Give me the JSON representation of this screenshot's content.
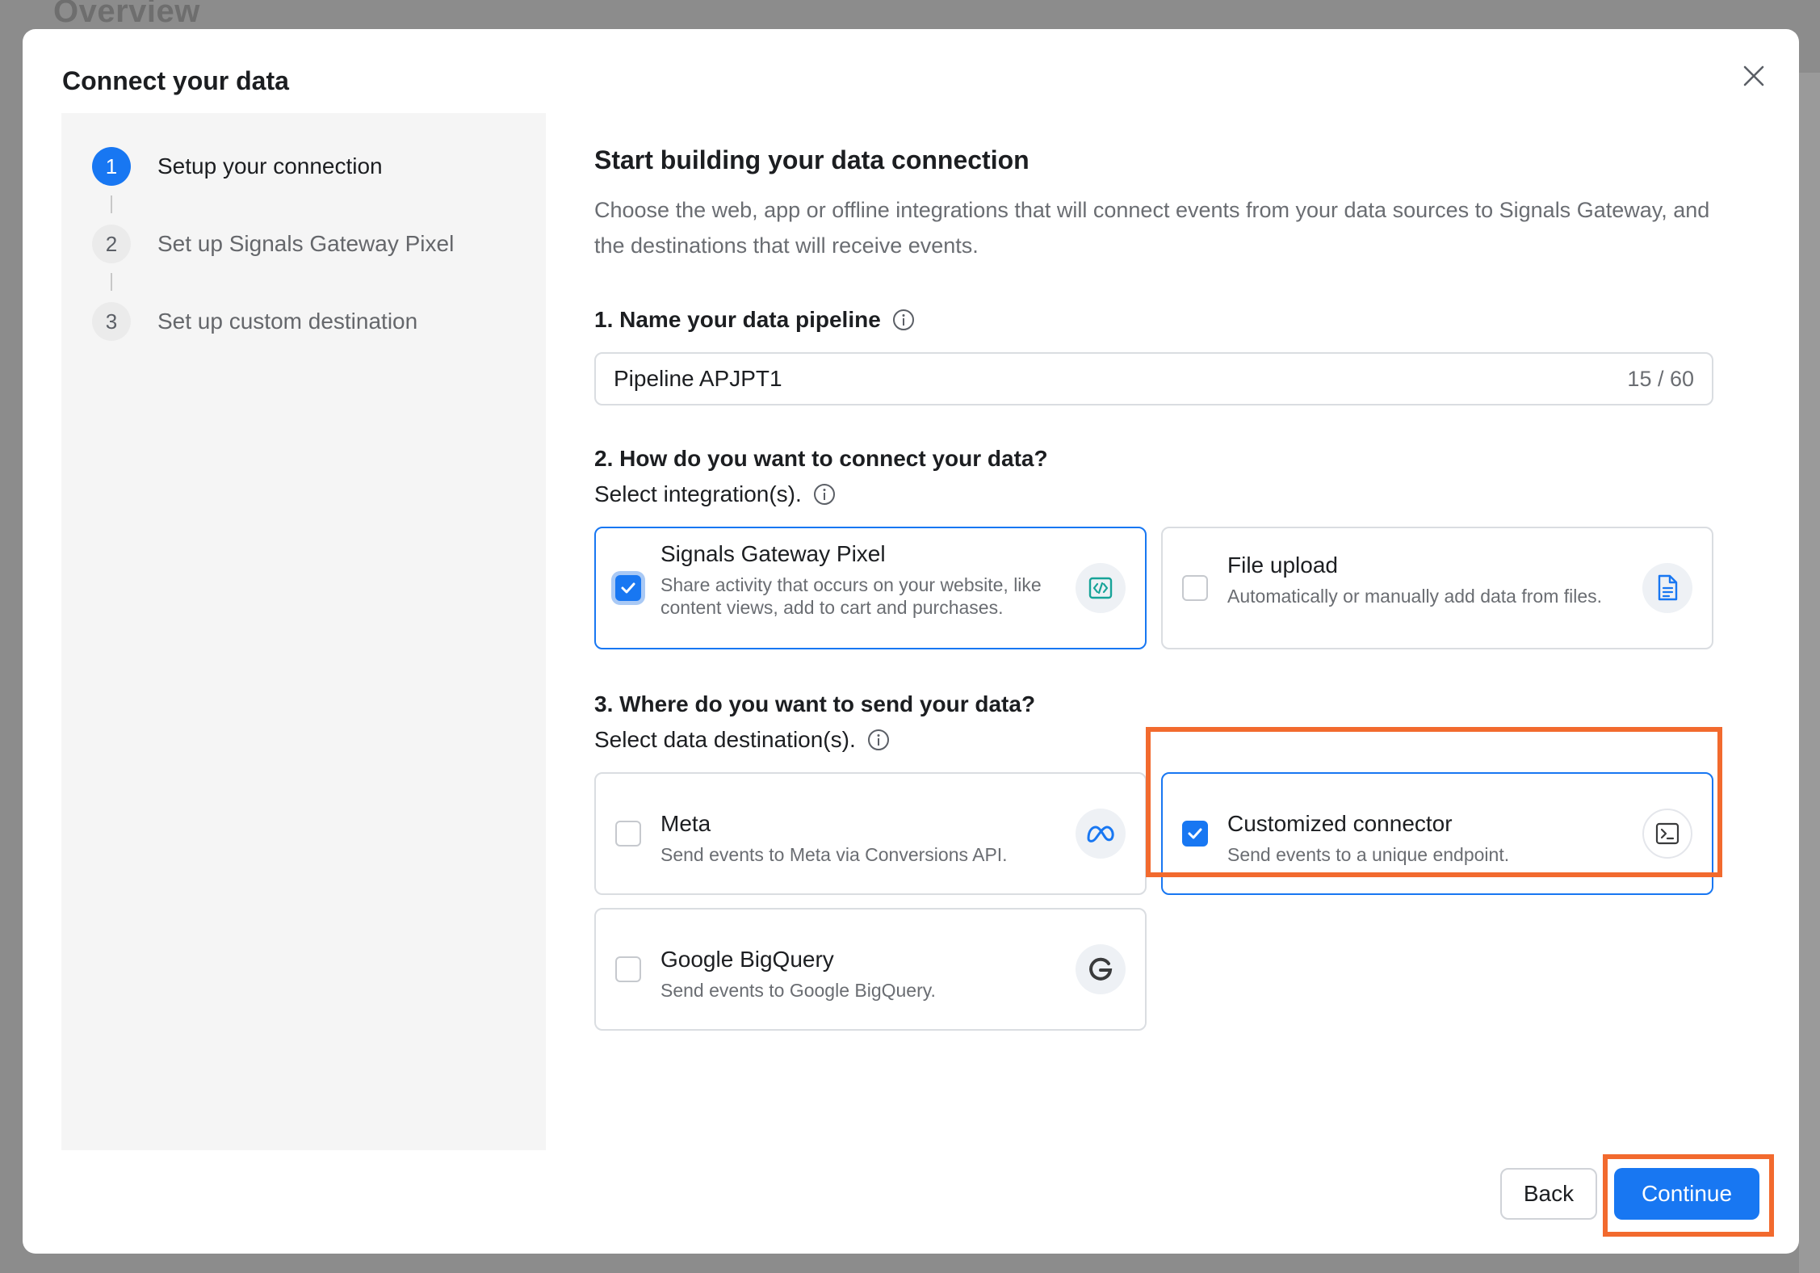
{
  "background": {
    "page_title": "Overview"
  },
  "modal": {
    "title": "Connect your data",
    "close_icon": "close-icon"
  },
  "steps": [
    {
      "number": "1",
      "label": "Setup your connection",
      "active": true
    },
    {
      "number": "2",
      "label": "Set up Signals Gateway Pixel",
      "active": false
    },
    {
      "number": "3",
      "label": "Set up custom destination",
      "active": false
    }
  ],
  "content": {
    "heading": "Start building your data connection",
    "description": "Choose the web, app or offline integrations that will connect events from your data sources to Signals Gateway, and the destinations that will receive events.",
    "section1": {
      "label": "1. Name your data pipeline",
      "input_value": "Pipeline APJPT1",
      "char_count": "15 / 60"
    },
    "section2": {
      "label": "2. How do you want to connect your data?",
      "sublabel": "Select integration(s).",
      "options": [
        {
          "title": "Signals Gateway Pixel",
          "description": "Share activity that occurs on your website, like content views, add to cart and purchases.",
          "checked": true,
          "icon": "code-icon"
        },
        {
          "title": "File upload",
          "description": "Automatically or manually add data from files.",
          "checked": false,
          "icon": "file-icon"
        }
      ]
    },
    "section3": {
      "label": "3. Where do you want to send your data?",
      "sublabel": "Select data destination(s).",
      "options": [
        {
          "title": "Meta",
          "description": "Send events to Meta via Conversions API.",
          "checked": false,
          "icon": "meta-icon"
        },
        {
          "title": "Customized connector",
          "description": "Send events to a unique endpoint.",
          "checked": true,
          "icon": "terminal-icon"
        },
        {
          "title": "Google BigQuery",
          "description": "Send events to Google BigQuery.",
          "checked": false,
          "icon": "google-icon"
        }
      ]
    }
  },
  "footer": {
    "back_label": "Back",
    "continue_label": "Continue"
  },
  "colors": {
    "accent": "#1877f2",
    "highlight": "#f26a2e",
    "overlay": "#8c8c8c"
  }
}
